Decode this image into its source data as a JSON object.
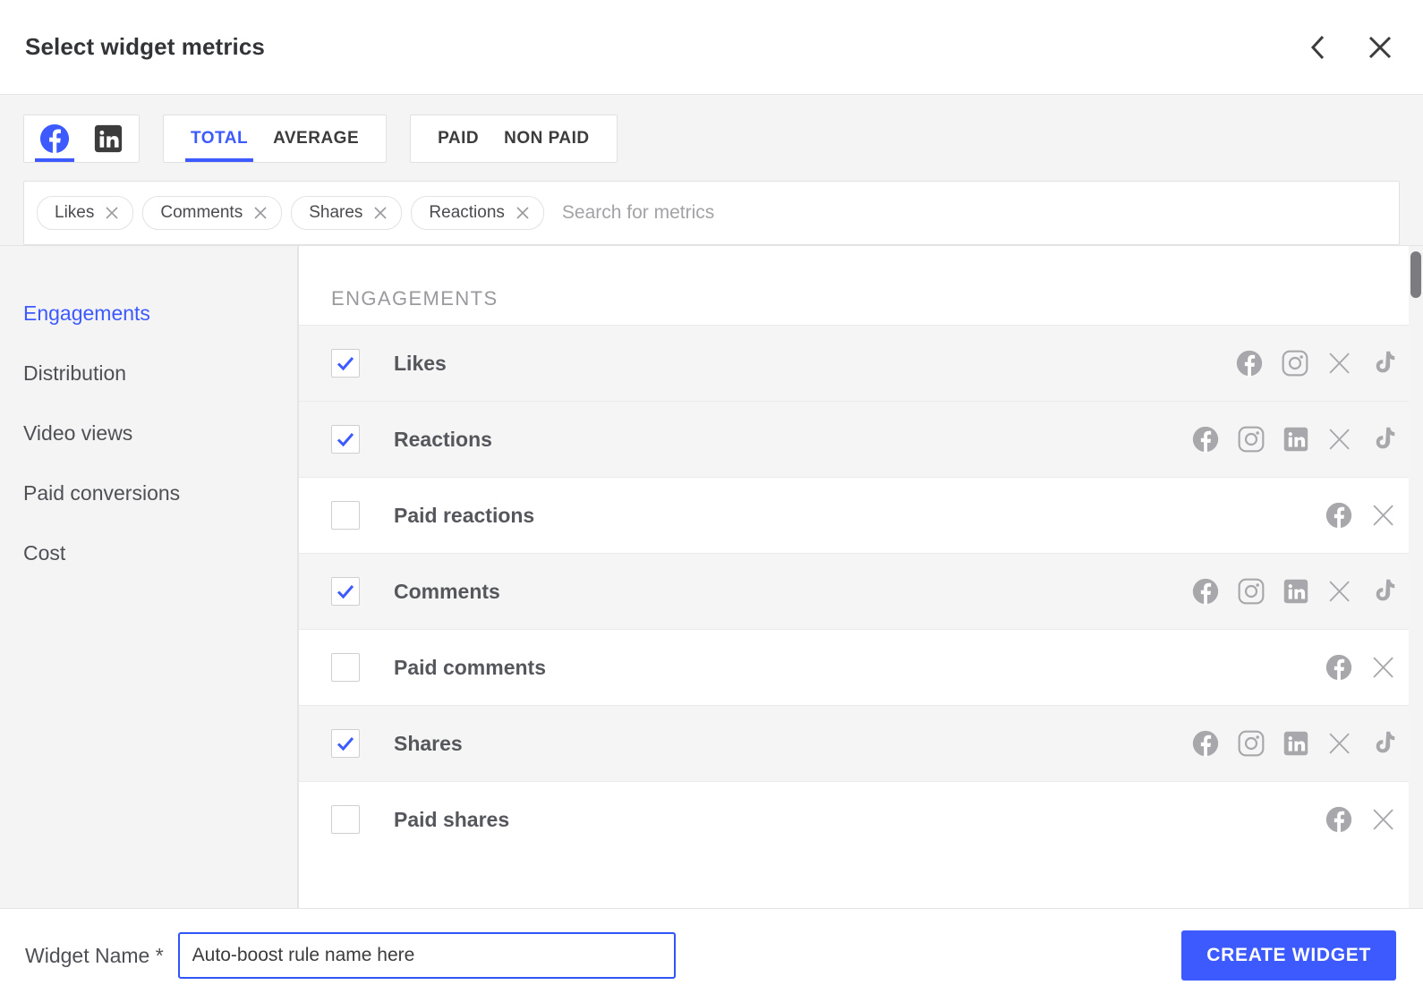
{
  "header": {
    "title": "Select widget metrics",
    "back_icon": "chevron-left-icon",
    "close_icon": "close-icon"
  },
  "toolbar": {
    "platforms": [
      {
        "name": "facebook",
        "icon": "facebook-icon",
        "active": true
      },
      {
        "name": "linkedin",
        "icon": "linkedin-icon",
        "active": false
      }
    ],
    "aggregation_tabs": [
      {
        "label": "TOTAL",
        "active": true
      },
      {
        "label": "AVERAGE",
        "active": false
      }
    ],
    "paid_tabs": [
      {
        "label": "PAID",
        "active": false
      },
      {
        "label": "NON PAID",
        "active": false
      }
    ]
  },
  "search": {
    "placeholder": "Search for metrics",
    "value": "",
    "chips": [
      {
        "label": "Likes",
        "remove_icon": "close-icon"
      },
      {
        "label": "Comments",
        "remove_icon": "close-icon"
      },
      {
        "label": "Shares",
        "remove_icon": "close-icon"
      },
      {
        "label": "Reactions",
        "remove_icon": "close-icon"
      }
    ]
  },
  "sidebar": {
    "items": [
      {
        "label": "Engagements",
        "active": true
      },
      {
        "label": "Distribution",
        "active": false
      },
      {
        "label": "Video views",
        "active": false
      },
      {
        "label": "Paid conversions",
        "active": false
      },
      {
        "label": "Cost",
        "active": false
      }
    ]
  },
  "main": {
    "group_title": "ENGAGEMENTS",
    "metrics": [
      {
        "label": "Likes",
        "checked": true,
        "platforms": [
          "facebook",
          "instagram",
          "x",
          "tiktok"
        ]
      },
      {
        "label": "Reactions",
        "checked": true,
        "platforms": [
          "facebook",
          "instagram",
          "linkedin",
          "x",
          "tiktok"
        ]
      },
      {
        "label": "Paid reactions",
        "checked": false,
        "platforms": [
          "facebook",
          "x"
        ]
      },
      {
        "label": "Comments",
        "checked": true,
        "platforms": [
          "facebook",
          "instagram",
          "linkedin",
          "x",
          "tiktok"
        ]
      },
      {
        "label": "Paid comments",
        "checked": false,
        "platforms": [
          "facebook",
          "x"
        ]
      },
      {
        "label": "Shares",
        "checked": true,
        "platforms": [
          "facebook",
          "instagram",
          "linkedin",
          "x",
          "tiktok"
        ]
      },
      {
        "label": "Paid shares",
        "checked": false,
        "platforms": [
          "facebook",
          "x"
        ]
      }
    ]
  },
  "footer": {
    "widget_name_label": "Widget Name *",
    "widget_name_value": "Auto-boost rule name here",
    "create_button": "CREATE WIDGET"
  },
  "colors": {
    "accent": "#3d5afe",
    "text": "#3c3c3c",
    "muted": "#9a9a9e",
    "row_checked_bg": "#f5f5f5"
  }
}
